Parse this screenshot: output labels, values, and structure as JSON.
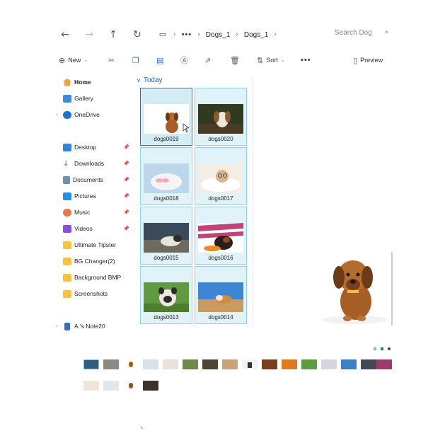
{
  "address_bar": {
    "more": "•••",
    "crumbs": [
      "Dogs_1",
      "Dogs_1"
    ],
    "search_placeholder": "Search Dog"
  },
  "toolbar": {
    "new_label": "New",
    "sort_label": "Sort",
    "more": "•••",
    "preview_label": "Preview"
  },
  "sidebar": {
    "items": [
      {
        "label": "Home",
        "icon": "home-icon"
      },
      {
        "label": "Gallery",
        "icon": "gallery-icon"
      },
      {
        "label": "OneDrive",
        "icon": "onedrive-icon"
      },
      {
        "label": "Desktop",
        "icon": "desktop-icon"
      },
      {
        "label": "Downloads",
        "icon": "downloads-icon"
      },
      {
        "label": "Documents",
        "icon": "documents-icon"
      },
      {
        "label": "Pictures",
        "icon": "pictures-icon"
      },
      {
        "label": "Music",
        "icon": "music-icon"
      },
      {
        "label": "Videos",
        "icon": "videos-icon"
      },
      {
        "label": "Ultimate Tipster",
        "icon": "folder-icon"
      },
      {
        "label": "BG Changer(2)",
        "icon": "folder-icon"
      },
      {
        "label": "Background BMP",
        "icon": "folder-icon"
      },
      {
        "label": "Screenshots",
        "icon": "folder-icon"
      },
      {
        "label": "A.'s Note20",
        "icon": "phone-icon"
      }
    ]
  },
  "files": {
    "group_label": "Today",
    "items": [
      {
        "name": "dogs0019",
        "selected": true
      },
      {
        "name": "dogs0020"
      },
      {
        "name": "dogs0018"
      },
      {
        "name": "dogs0017"
      },
      {
        "name": "dogs0015"
      },
      {
        "name": "dogs0016"
      },
      {
        "name": "dogs0013"
      },
      {
        "name": "dogs0014"
      }
    ]
  },
  "colors": {
    "accent": "#2b6fbd",
    "tile_bg": "#dff3f8",
    "tile_border": "#8fd2e6",
    "folder": "#f6c443"
  }
}
